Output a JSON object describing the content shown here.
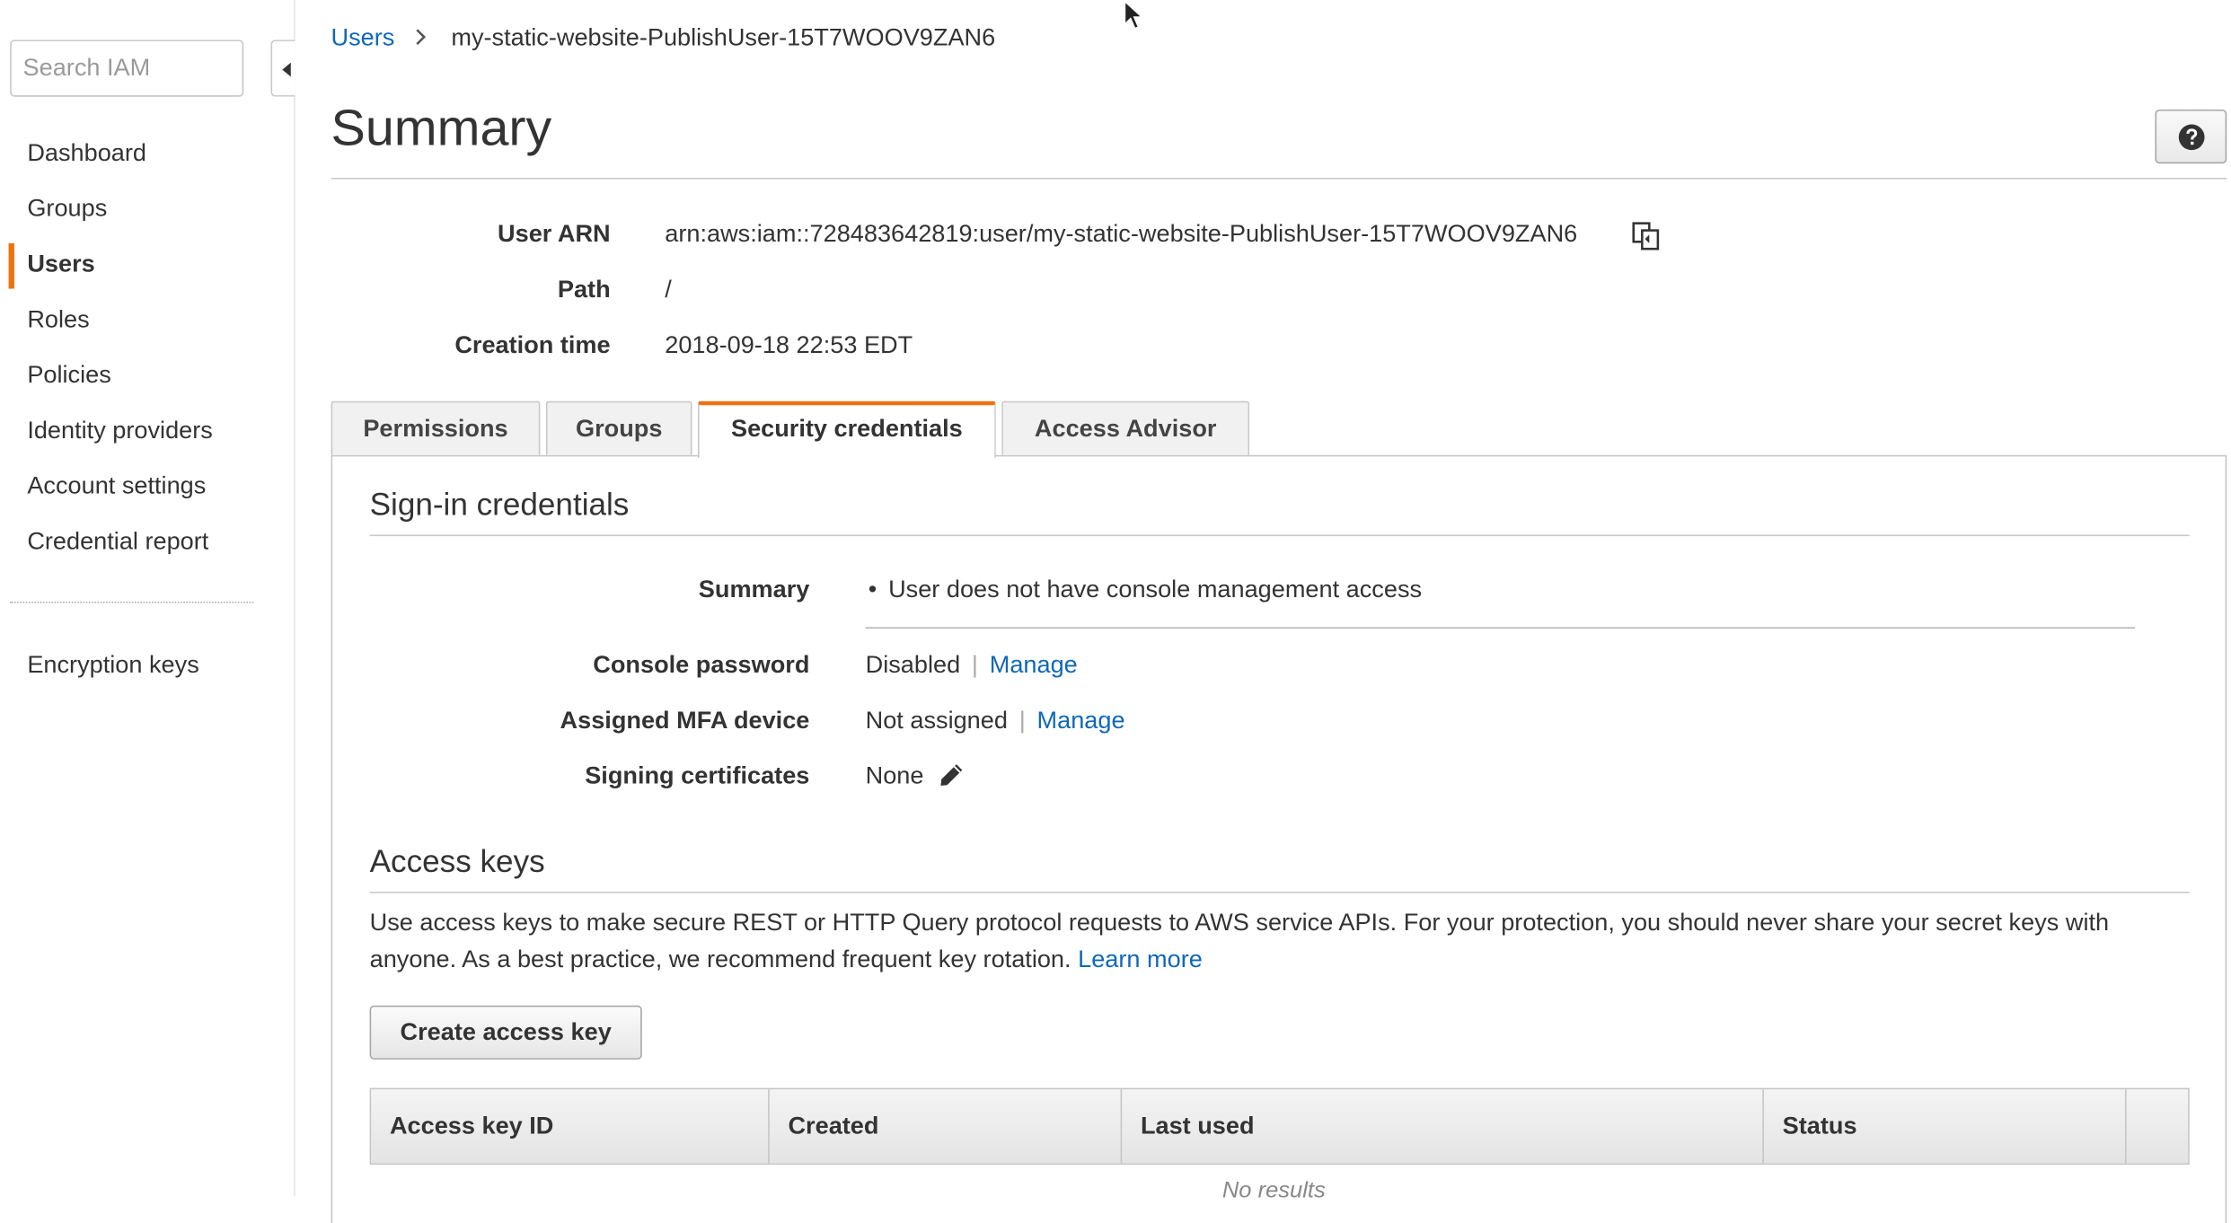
{
  "sidebar": {
    "search_placeholder": "Search IAM",
    "items": [
      {
        "label": "Dashboard",
        "active": false
      },
      {
        "label": "Groups",
        "active": false
      },
      {
        "label": "Users",
        "active": true
      },
      {
        "label": "Roles",
        "active": false
      },
      {
        "label": "Policies",
        "active": false
      },
      {
        "label": "Identity providers",
        "active": false
      },
      {
        "label": "Account settings",
        "active": false
      },
      {
        "label": "Credential report",
        "active": false
      }
    ],
    "secondary_items": [
      {
        "label": "Encryption keys"
      }
    ]
  },
  "breadcrumb": {
    "parent": "Users",
    "current": "my-static-website-PublishUser-15T7WOOV9ZAN6"
  },
  "page": {
    "title": "Summary"
  },
  "summary": {
    "arn_label": "User ARN",
    "arn_value": "arn:aws:iam::728483642819:user/my-static-website-PublishUser-15T7WOOV9ZAN6",
    "path_label": "Path",
    "path_value": "/",
    "creation_label": "Creation time",
    "creation_value": "2018-09-18 22:53 EDT"
  },
  "tabs": [
    {
      "label": "Permissions",
      "active": false
    },
    {
      "label": "Groups",
      "active": false
    },
    {
      "label": "Security credentials",
      "active": true
    },
    {
      "label": "Access Advisor",
      "active": false
    }
  ],
  "signin": {
    "title": "Sign-in credentials",
    "summary_label": "Summary",
    "summary_value": "User does not have console management access",
    "console_password_label": "Console password",
    "console_password_value": "Disabled",
    "console_password_action": "Manage",
    "mfa_label": "Assigned MFA device",
    "mfa_value": "Not assigned",
    "mfa_action": "Manage",
    "signing_label": "Signing certificates",
    "signing_value": "None"
  },
  "access_keys": {
    "title": "Access keys",
    "description": "Use access keys to make secure REST or HTTP Query protocol requests to AWS service APIs. For your protection, you should never share your secret keys with anyone. As a best practice, we recommend frequent key rotation.",
    "learn_more": "Learn more",
    "create_button": "Create access key",
    "columns": [
      "Access key ID",
      "Created",
      "Last used",
      "Status"
    ],
    "empty_text": "No results"
  },
  "colors": {
    "accent": "#ec7211",
    "link": "#0f68b7"
  }
}
